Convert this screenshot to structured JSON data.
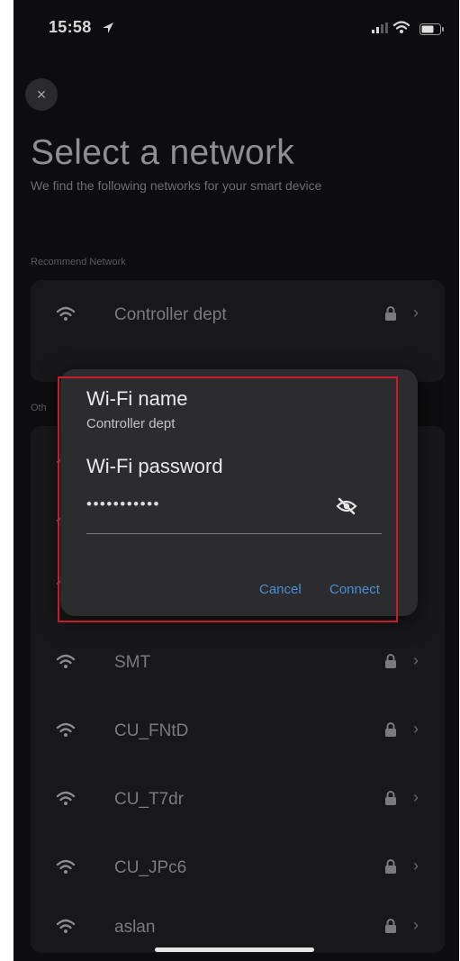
{
  "status_bar": {
    "time": "15:58"
  },
  "header": {
    "close_label": "×",
    "title": "Select a network",
    "subtitle": "We find the following networks for your smart device"
  },
  "sections": {
    "recommend_label": "Recommend Network",
    "other_label": "Oth"
  },
  "recommended_network": {
    "name": "Controller dept",
    "chevron": "›"
  },
  "other_networks": [
    {
      "name": "SMT",
      "chevron": "›"
    },
    {
      "name": "CU_FNtD",
      "chevron": "›"
    },
    {
      "name": "CU_T7dr",
      "chevron": "›"
    },
    {
      "name": "CU_JPc6",
      "chevron": "›"
    },
    {
      "name": "aslan",
      "chevron": "›"
    }
  ],
  "dialog": {
    "wifi_name_label": "Wi-Fi name",
    "wifi_name_value": "Controller dept",
    "wifi_password_label": "Wi-Fi password",
    "password_value": "•••••••••••",
    "cancel_label": "Cancel",
    "connect_label": "Connect"
  },
  "colors": {
    "accent": "#4a8fd6",
    "highlight_border": "#c61d2b",
    "background": "#0d0d0f"
  }
}
